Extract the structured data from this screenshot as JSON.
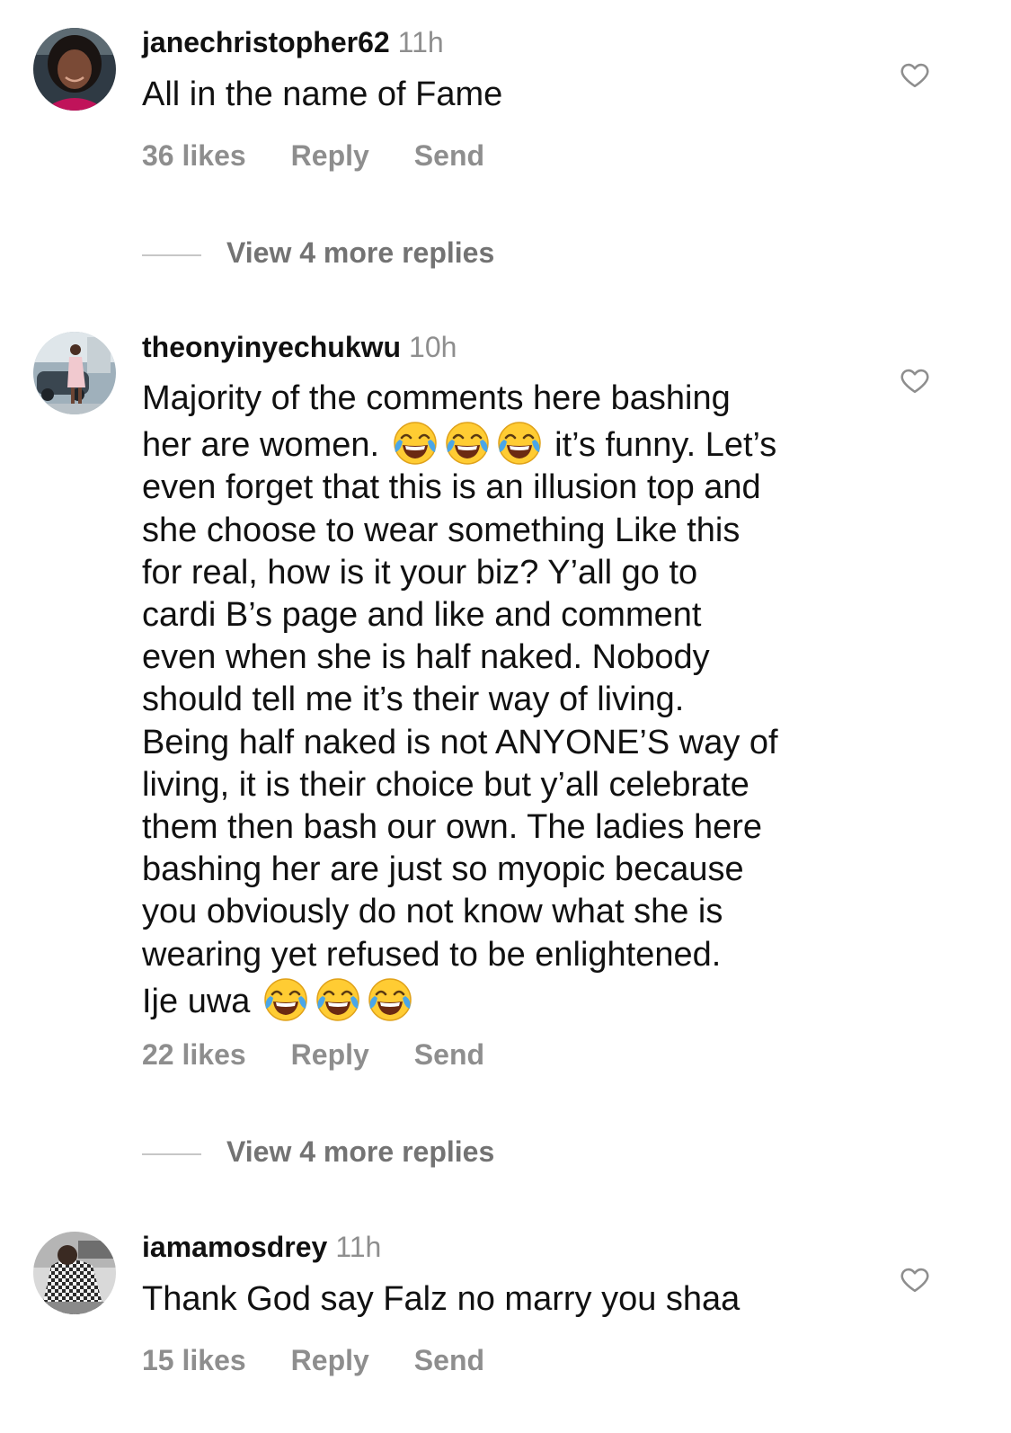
{
  "comments": [
    {
      "username": "janechristopher62",
      "time": "11h",
      "text": "All in the name of Fame",
      "likes": "36 likes",
      "reply_label": "Reply",
      "send_label": "Send",
      "view_replies": "View 4 more replies"
    },
    {
      "username": "theonyinyechukwu",
      "time": "10h",
      "text_parts": [
        "Majority of the comments here bashing\nher are women. ",
        " it’s funny. Let’s\neven forget that this is an illusion top and\nshe choose to wear something Like this\nfor real, how is it your biz? Y’all go to\ncardi B’s page and like and comment\neven when she is half naked. Nobody\nshould tell me it’s their way of living.\nBeing half naked is not ANYONE’S way of\nliving, it is their choice but y’all celebrate\nthem then bash our own. The ladies here\nbashing her are just so myopic because\nyou obviously do not know what she is\nwearing yet refused to be enlightened.\nIje uwa "
      ],
      "emoji": "face-with-tears-of-joy",
      "likes": "22 likes",
      "reply_label": "Reply",
      "send_label": "Send",
      "view_replies": "View 4 more replies"
    },
    {
      "username": "iamamosdrey",
      "time": "11h",
      "text": "Thank God say Falz no marry you shaa",
      "likes": "15 likes",
      "reply_label": "Reply",
      "send_label": "Send"
    }
  ],
  "icons": {
    "like": "heart-outline-icon",
    "emoji": "face-with-tears-of-joy"
  },
  "colors": {
    "text": "#111111",
    "muted": "#8e8e8e",
    "view_replies": "#737373",
    "divider": "#c7c7c7",
    "emoji_face": "#FFCC33"
  }
}
